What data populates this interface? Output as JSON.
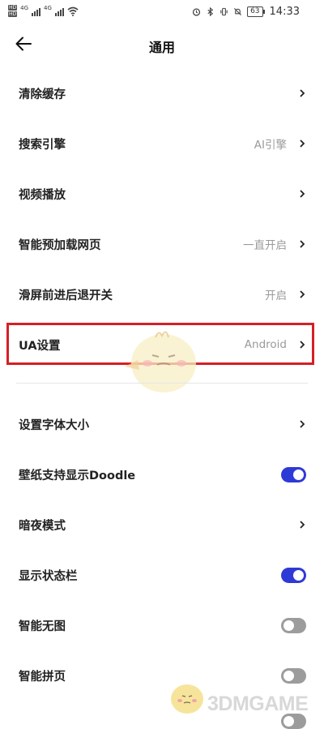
{
  "status_bar": {
    "sim1": "HD",
    "sim2": "HD",
    "net1": "4G",
    "net2": "4G",
    "battery": "63",
    "time": "14:33"
  },
  "header": {
    "title": "通用"
  },
  "settings": {
    "clear_cache": {
      "label": "清除缓存",
      "value": ""
    },
    "search_engine": {
      "label": "搜索引擎",
      "value": "AI引擎"
    },
    "video_playback": {
      "label": "视频播放",
      "value": ""
    },
    "preload_pages": {
      "label": "智能预加载网页",
      "value": "一直开启"
    },
    "swipe_nav": {
      "label": "滑屏前进后退开关",
      "value": "开启"
    },
    "ua_settings": {
      "label": "UA设置",
      "value": "Android"
    },
    "font_size": {
      "label": "设置字体大小",
      "value": ""
    },
    "wallpaper_doodle": {
      "label": "壁纸支持显示Doodle",
      "toggle": true
    },
    "night_mode": {
      "label": "暗夜模式",
      "value": ""
    },
    "show_status_bar": {
      "label": "显示状态栏",
      "toggle": true
    },
    "smart_no_image": {
      "label": "智能无图",
      "toggle": false
    },
    "smart_page_join": {
      "label": "智能拼页",
      "toggle": false
    }
  },
  "watermark": {
    "text": "3DMGAME"
  },
  "colors": {
    "toggle_on": "#2e3ad6",
    "toggle_off": "#9c9c9c",
    "highlight_border": "#d51f26"
  }
}
